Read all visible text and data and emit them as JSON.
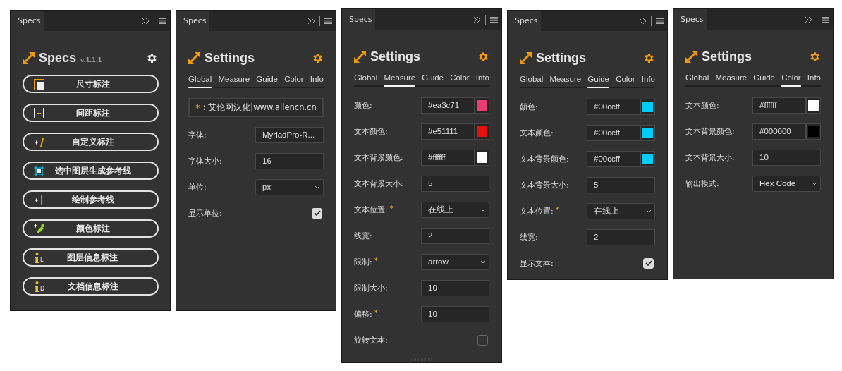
{
  "panels": [
    {
      "kind": "main",
      "tab": "Specs",
      "title": "Specs",
      "version": "v.1.1.1",
      "buttons": [
        {
          "label": "尺寸标注",
          "kind": "size"
        },
        {
          "label": "间距标注",
          "kind": "spacing"
        },
        {
          "label": "自定义标注",
          "kind": "custom"
        },
        {
          "label": "选中图层生成参考线",
          "kind": "layerguide"
        },
        {
          "label": "绘制参考线",
          "kind": "drawguide"
        },
        {
          "label": "颜色标注",
          "kind": "color"
        },
        {
          "label": "图层信息标注",
          "kind": "info",
          "icon_letter": "L"
        },
        {
          "label": "文档信息标注",
          "kind": "info",
          "icon_letter": "D"
        }
      ]
    },
    {
      "kind": "settings",
      "tab": "Specs",
      "title": "Settings",
      "tabs": [
        {
          "label": "Global",
          "selected": true
        },
        {
          "label": "Measure",
          "selected": false
        },
        {
          "label": "Guide",
          "selected": false
        },
        {
          "label": "Color",
          "selected": false
        },
        {
          "label": "Info",
          "selected": false
        }
      ],
      "rows": [
        {
          "kind": "note",
          "star": "*",
          "text": ": 艾伦网汉化|www.allencn.cn"
        },
        {
          "kind": "text",
          "label": "字体:",
          "value": "MyriadPro-R..."
        },
        {
          "kind": "text",
          "label": "字体大小:",
          "value": "16"
        },
        {
          "kind": "select",
          "label": "单位:",
          "value": "px"
        },
        {
          "kind": "checkbox",
          "label": "显示单位:",
          "checked": true
        }
      ]
    },
    {
      "kind": "settings",
      "tab": "Specs",
      "title": "Settings",
      "tabs": [
        {
          "label": "Global",
          "selected": false
        },
        {
          "label": "Measure",
          "selected": true
        },
        {
          "label": "Guide",
          "selected": false
        },
        {
          "label": "Color",
          "selected": false
        },
        {
          "label": "Info",
          "selected": false
        }
      ],
      "rows": [
        {
          "kind": "color",
          "label": "颜色:",
          "value": "#ea3c71",
          "color": "#ea3c71"
        },
        {
          "kind": "color",
          "label": "文本颜色:",
          "value": "#e51111",
          "color": "#e51111"
        },
        {
          "kind": "color",
          "label": "文本背景颜色:",
          "value": "#ffffff",
          "color": "#ffffff"
        },
        {
          "kind": "text",
          "label": "文本背景大小:",
          "value": "5"
        },
        {
          "kind": "select",
          "label": "文本位置:",
          "star": "*",
          "value": "在线上"
        },
        {
          "kind": "text",
          "label": "线宽:",
          "value": "2"
        },
        {
          "kind": "select",
          "label": "限制:",
          "star": "*",
          "value": "arrow"
        },
        {
          "kind": "text",
          "label": "限制大小:",
          "value": "10"
        },
        {
          "kind": "text",
          "label": "偏移:",
          "star": "*",
          "value": "10"
        },
        {
          "kind": "checkbox",
          "label": "旋转文本:",
          "checked": false
        }
      ]
    },
    {
      "kind": "settings",
      "tab": "Specs",
      "title": "Settings",
      "tabs": [
        {
          "label": "Global",
          "selected": false
        },
        {
          "label": "Measure",
          "selected": false
        },
        {
          "label": "Guide",
          "selected": true
        },
        {
          "label": "Color",
          "selected": false
        },
        {
          "label": "Info",
          "selected": false
        }
      ],
      "rows": [
        {
          "kind": "color",
          "label": "颜色:",
          "value": "#00ccff",
          "color": "#00ccff"
        },
        {
          "kind": "color",
          "label": "文本颜色:",
          "value": "#00ccff",
          "color": "#00ccff"
        },
        {
          "kind": "color",
          "label": "文本背景颜色:",
          "value": "#00ccff",
          "color": "#00ccff"
        },
        {
          "kind": "text",
          "label": "文本背景大小:",
          "value": "5"
        },
        {
          "kind": "select",
          "label": "文本位置:",
          "star": "*",
          "value": "在线上"
        },
        {
          "kind": "text",
          "label": "线宽:",
          "value": "2"
        },
        {
          "kind": "checkbox",
          "label": "显示文本:",
          "checked": true
        }
      ]
    },
    {
      "kind": "settings",
      "tab": "Specs",
      "title": "Settings",
      "tabs": [
        {
          "label": "Global",
          "selected": false
        },
        {
          "label": "Measure",
          "selected": false
        },
        {
          "label": "Guide",
          "selected": false
        },
        {
          "label": "Color",
          "selected": true
        },
        {
          "label": "Info",
          "selected": false
        }
      ],
      "rows": [
        {
          "kind": "color",
          "label": "文本颜色:",
          "value": "#ffffff",
          "color": "#ffffff"
        },
        {
          "kind": "color",
          "label": "文本背景颜色:",
          "value": "#000000",
          "color": "#000000"
        },
        {
          "kind": "text",
          "label": "文本背景大小:",
          "value": "10"
        },
        {
          "kind": "select",
          "label": "输出模式:",
          "value": "Hex Code"
        }
      ]
    }
  ]
}
